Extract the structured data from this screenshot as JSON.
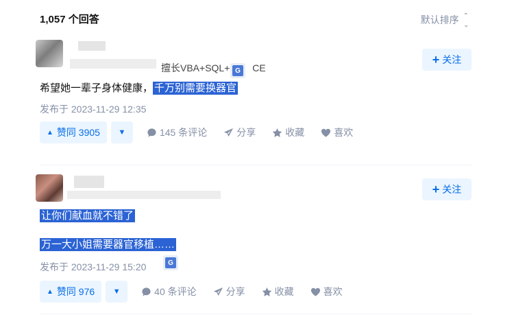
{
  "header": {
    "answer_count": "1,057 个回答",
    "sort_label": "默认排序"
  },
  "answers": [
    {
      "tagline": "擅长VBA+SQL+O",
      "tagline_tail": "CE",
      "content_plain": "希望她一辈子身体健康，",
      "content_highlight": "千万别需要换器官",
      "date": "发布于 2023-11-29 12:35",
      "follow": "关注",
      "upvote": "赞同 3905",
      "comments": "145 条评论",
      "share": "分享",
      "collect": "收藏",
      "like": "喜欢"
    },
    {
      "line1_highlight": "让你们献血就不错了",
      "line2_highlight": "万一大小姐需要器官移植……",
      "date": "发布于 2023-11-29 15:20",
      "follow": "关注",
      "upvote": "赞同 976",
      "comments": "40 条评论",
      "share": "分享",
      "collect": "收藏",
      "like": "喜欢"
    }
  ],
  "colors": {
    "accent": "#056de8",
    "accent_bg": "#ebf5ff",
    "selection": "#2b63d4",
    "meta": "#8590a6"
  }
}
